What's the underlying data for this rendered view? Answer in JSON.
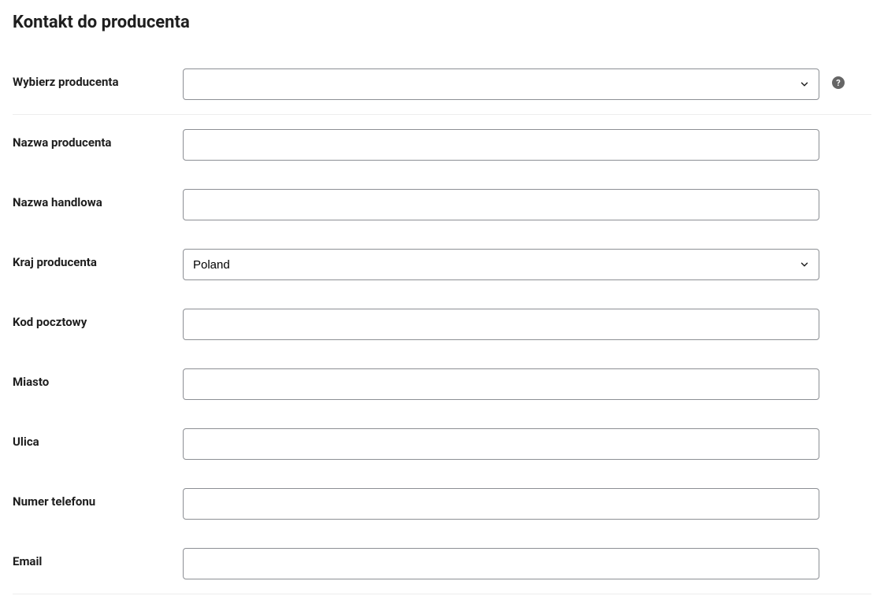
{
  "section": {
    "title": "Kontakt do producenta"
  },
  "fields": {
    "select_producer": {
      "label": "Wybierz producenta",
      "value": ""
    },
    "producer_name": {
      "label": "Nazwa producenta",
      "value": ""
    },
    "trade_name": {
      "label": "Nazwa handlowa",
      "value": ""
    },
    "producer_country": {
      "label": "Kraj producenta",
      "value": "Poland"
    },
    "postal_code": {
      "label": "Kod pocztowy",
      "value": ""
    },
    "city": {
      "label": "Miasto",
      "value": ""
    },
    "street": {
      "label": "Ulica",
      "value": ""
    },
    "phone": {
      "label": "Numer telefonu",
      "value": ""
    },
    "email": {
      "label": "Email",
      "value": ""
    }
  },
  "help_tooltip": "?"
}
